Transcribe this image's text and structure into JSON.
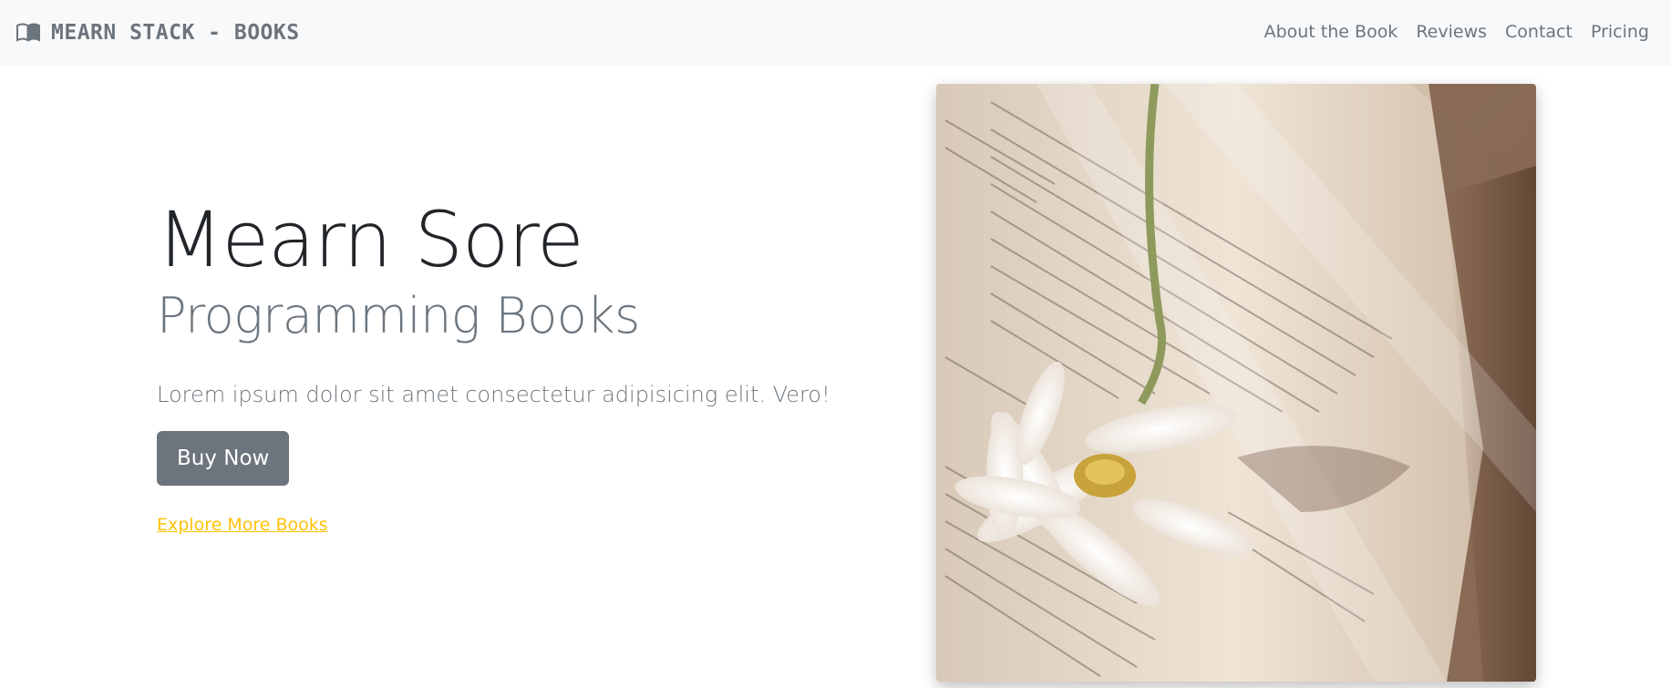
{
  "navbar": {
    "brand": {
      "icon": "book-open-icon",
      "text": "MEARN STACK - BOOKS"
    },
    "links": [
      {
        "label": "About the Book"
      },
      {
        "label": "Reviews"
      },
      {
        "label": "Contact"
      },
      {
        "label": "Pricing"
      }
    ]
  },
  "hero": {
    "title": "Mearn Sore",
    "subtitle": "Programming Books",
    "lead": "Lorem ipsum dolor sit amet consectetur adipisicing elit. Vero!",
    "buy_label": "Buy Now",
    "explore_label": "Explore More Books"
  },
  "colors": {
    "nav_bg": "#f8f9fa",
    "muted": "#6c757d",
    "dark": "#212529",
    "link_warning": "#ffc107",
    "button_bg": "#6c757d"
  }
}
